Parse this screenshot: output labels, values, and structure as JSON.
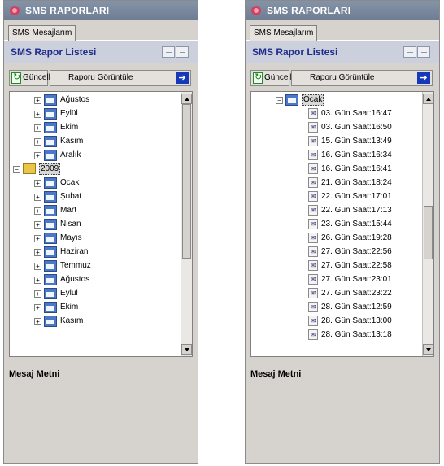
{
  "panels": [
    {
      "title": "SMS RAPORLARI",
      "tab": "SMS Mesajlarım",
      "list_title": "SMS  Rapor Listesi",
      "refresh_label": "Güncelle",
      "view_label": "Raporu Görüntüle",
      "message_title": "Mesaj Metni",
      "tree": [
        {
          "label": "Ağustos",
          "level": 2,
          "kind": "month",
          "expander": "+"
        },
        {
          "label": "Eylül",
          "level": 2,
          "kind": "month",
          "expander": "+"
        },
        {
          "label": "Ekim",
          "level": 2,
          "kind": "month",
          "expander": "+"
        },
        {
          "label": "Kasım",
          "level": 2,
          "kind": "month",
          "expander": "+"
        },
        {
          "label": "Aralık",
          "level": 2,
          "kind": "month",
          "expander": "+"
        },
        {
          "label": "2009",
          "level": 1,
          "kind": "year",
          "expander": "−",
          "selected": true
        },
        {
          "label": "Ocak",
          "level": 2,
          "kind": "month",
          "expander": "+"
        },
        {
          "label": "Şubat",
          "level": 2,
          "kind": "month",
          "expander": "+"
        },
        {
          "label": "Mart",
          "level": 2,
          "kind": "month",
          "expander": "+"
        },
        {
          "label": "Nisan",
          "level": 2,
          "kind": "month",
          "expander": "+"
        },
        {
          "label": "Mayıs",
          "level": 2,
          "kind": "month",
          "expander": "+"
        },
        {
          "label": "Haziran",
          "level": 2,
          "kind": "month",
          "expander": "+"
        },
        {
          "label": "Temmuz",
          "level": 2,
          "kind": "month",
          "expander": "+"
        },
        {
          "label": "Ağustos",
          "level": 2,
          "kind": "month",
          "expander": "+"
        },
        {
          "label": "Eylül",
          "level": 2,
          "kind": "month",
          "expander": "+"
        },
        {
          "label": "Ekim",
          "level": 2,
          "kind": "month",
          "expander": "+"
        },
        {
          "label": "Kasım",
          "level": 2,
          "kind": "month",
          "expander": "+"
        }
      ]
    },
    {
      "title": "SMS RAPORLARI",
      "tab": "SMS Mesajlarım",
      "list_title": "SMS  Rapor Listesi",
      "refresh_label": "Güncelle",
      "view_label": "Raporu Görüntüle",
      "message_title": "Mesaj Metni",
      "tree": [
        {
          "label": "Ocak",
          "level": 1,
          "kind": "month",
          "expander": "−",
          "selected": true
        },
        {
          "label": "03. Gün Saat:16:47",
          "level": 3,
          "kind": "report"
        },
        {
          "label": "03. Gün Saat:16:50",
          "level": 3,
          "kind": "report"
        },
        {
          "label": "15. Gün Saat:13:49",
          "level": 3,
          "kind": "report"
        },
        {
          "label": "16. Gün Saat:16:34",
          "level": 3,
          "kind": "report"
        },
        {
          "label": "16. Gün Saat:16:41",
          "level": 3,
          "kind": "report"
        },
        {
          "label": "21. Gün Saat:18:24",
          "level": 3,
          "kind": "report"
        },
        {
          "label": "22. Gün Saat:17:01",
          "level": 3,
          "kind": "report"
        },
        {
          "label": "22. Gün Saat:17:13",
          "level": 3,
          "kind": "report"
        },
        {
          "label": "23. Gün Saat:15:44",
          "level": 3,
          "kind": "report"
        },
        {
          "label": "26. Gün Saat:19:28",
          "level": 3,
          "kind": "report"
        },
        {
          "label": "27. Gün Saat:22:56",
          "level": 3,
          "kind": "report"
        },
        {
          "label": "27. Gün Saat:22:58",
          "level": 3,
          "kind": "report"
        },
        {
          "label": "27. Gün Saat:23:01",
          "level": 3,
          "kind": "report"
        },
        {
          "label": "27. Gün Saat:23:22",
          "level": 3,
          "kind": "report"
        },
        {
          "label": "28. Gün Saat:12:59",
          "level": 3,
          "kind": "report"
        },
        {
          "label": "28. Gün Saat:13:00",
          "level": 3,
          "kind": "report"
        },
        {
          "label": "28. Gün Saat:13:18",
          "level": 3,
          "kind": "report"
        }
      ]
    }
  ]
}
